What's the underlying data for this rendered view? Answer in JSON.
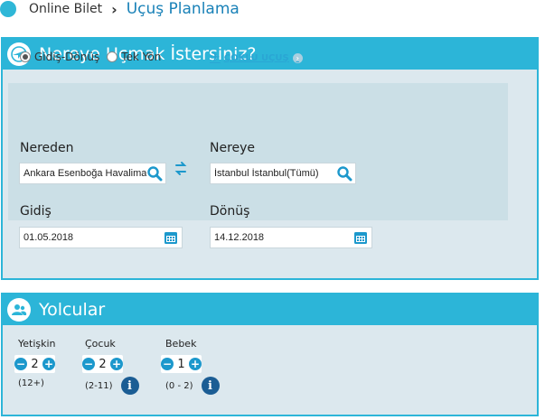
{
  "breadcrumb": {
    "home": "Online Bilet",
    "separator": "›",
    "current": "Uçuş Planlama"
  },
  "flight_panel": {
    "title": "Nereye Uçmak İstersiniz?",
    "trip_types": [
      {
        "label": "Gidiş-Dönüş",
        "selected": true
      },
      {
        "label": "Tek Yön",
        "selected": false
      }
    ],
    "multi_flight_label": "ÇOKLU UÇUŞ",
    "from": {
      "label": "Nereden",
      "value": "Ankara Esenboğa Havalimanı"
    },
    "to": {
      "label": "Nereye",
      "value": "İstanbul İstanbul(Tümü)"
    },
    "depart": {
      "label": "Gidiş",
      "value": "01.05.2018"
    },
    "return": {
      "label": "Dönüş",
      "value": "14.12.2018"
    }
  },
  "passengers_panel": {
    "title": "Yolcular",
    "groups": [
      {
        "label": "Yetişkin",
        "count": "2",
        "range": "(12+)"
      },
      {
        "label": "Çocuk",
        "count": "2",
        "range": "(2-11)"
      },
      {
        "label": "Bebek",
        "count": "1",
        "range": "(0 - 2)"
      }
    ]
  },
  "colors": {
    "accent": "#2cb5d8",
    "panel_bg": "#dce8ee",
    "inner_bg": "#cbdfe6",
    "stepper_blue": "#1c98cc",
    "info_blue": "#1b5d94"
  },
  "icons": [
    "home-icon",
    "globe-plane-icon",
    "plane-icon",
    "chevron-right-icon",
    "search-icon",
    "swap-icon",
    "calendar-icon",
    "users-icon",
    "minus-icon",
    "plus-icon",
    "info-icon"
  ]
}
